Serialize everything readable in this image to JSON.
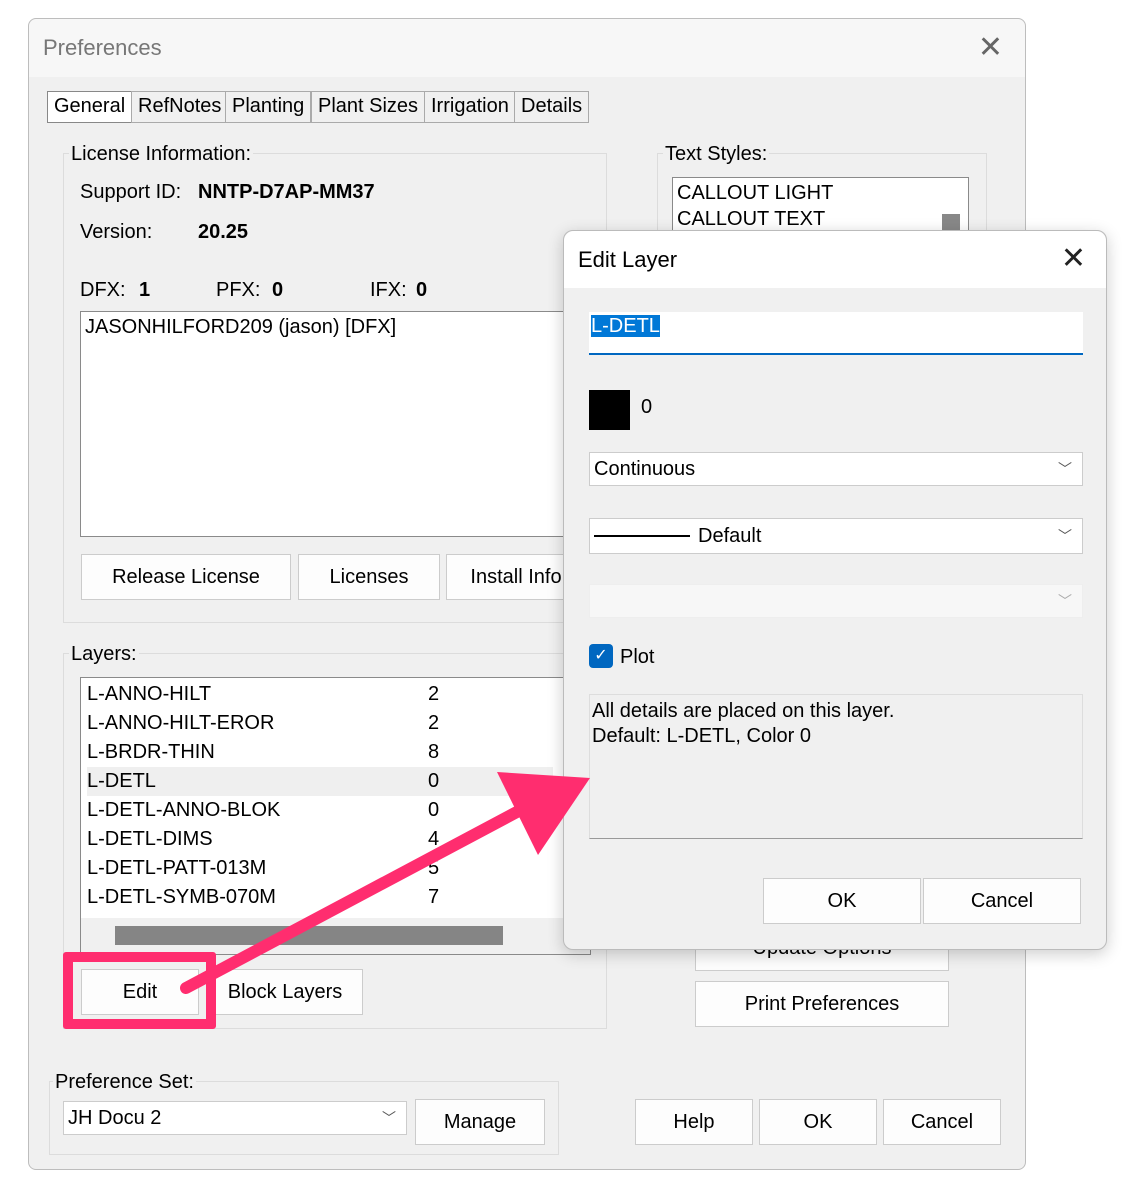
{
  "preferences": {
    "title": "Preferences",
    "tabs": [
      "General",
      "RefNotes",
      "Planting",
      "Plant Sizes",
      "Irrigation",
      "Details"
    ],
    "license": {
      "label": "License Information:",
      "support_id_label": "Support ID:",
      "support_id": "NNTP-D7AP-MM37",
      "version_label": "Version:",
      "version": "20.25",
      "dfx_label": "DFX:",
      "dfx": "1",
      "pfx_label": "PFX:",
      "pfx": "0",
      "ifx_label": "IFX:",
      "ifx": "0",
      "users": [
        "JASONHILFORD209 (jason) [DFX]"
      ],
      "release_button": "Release License",
      "licenses_button": "Licenses",
      "install_info_button": "Install Info"
    },
    "text_styles": {
      "label": "Text Styles:",
      "items": [
        "CALLOUT LIGHT",
        "CALLOUT TEXT"
      ]
    },
    "layers": {
      "label": "Layers:",
      "items": [
        {
          "name": "L-ANNO-HILT",
          "color": "2"
        },
        {
          "name": "L-ANNO-HILT-EROR",
          "color": "2"
        },
        {
          "name": "L-BRDR-THIN",
          "color": "8"
        },
        {
          "name": "L-DETL",
          "color": "0",
          "selected": true
        },
        {
          "name": "L-DETL-ANNO-BLOK",
          "color": "0"
        },
        {
          "name": "L-DETL-DIMS",
          "color": "4"
        },
        {
          "name": "L-DETL-PATT-013M",
          "color": "5"
        },
        {
          "name": "L-DETL-SYMB-070M",
          "color": "7"
        }
      ],
      "edit_button": "Edit",
      "block_layers_button": "Block Layers"
    },
    "update_options_button": "Update Options",
    "print_preferences_button": "Print Preferences",
    "preference_set": {
      "label": "Preference Set:",
      "value": "JH Docu 2",
      "manage_button": "Manage"
    },
    "help_button": "Help",
    "ok_button": "OK",
    "cancel_button": "Cancel"
  },
  "edit_layer": {
    "title": "Edit Layer",
    "name_value": "L-DETL",
    "color_value": "0",
    "color_swatch": "#000000",
    "linetype": "Continuous",
    "lineweight": "Default",
    "plot_label": "Plot",
    "plot_checked": true,
    "description": "All details are placed on this layer.\nDefault: L-DETL, Color 0",
    "ok_button": "OK",
    "cancel_button": "Cancel"
  },
  "annotation": {
    "color": "#ff2d6f"
  }
}
